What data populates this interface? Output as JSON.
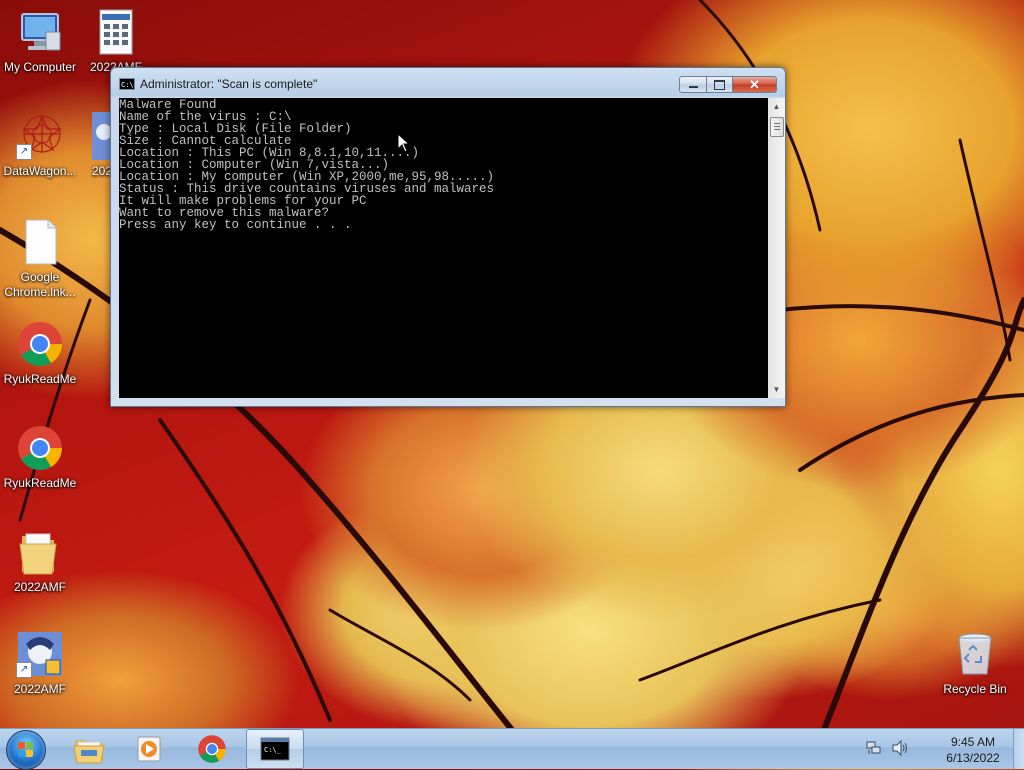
{
  "desktop": {
    "icons": [
      {
        "label": "My Computer",
        "icon": "computer-icon"
      },
      {
        "label": "2022AMF",
        "icon": "document-grid-icon"
      },
      {
        "label": "DataWagon...",
        "icon": "red-star-shortcut-icon"
      },
      {
        "label": "202",
        "icon": "anime-avatar-icon"
      },
      {
        "label": "Google Chrome.lnk...",
        "icon": "blank-file-icon"
      },
      {
        "label": "RyukReadMe",
        "icon": "chrome-icon"
      },
      {
        "label": "RyukReadMe",
        "icon": "chrome-icon"
      },
      {
        "label": "2022AMF",
        "icon": "folder-icon"
      },
      {
        "label": "2022AMF",
        "icon": "anime-avatar-icon"
      },
      {
        "label": "Recycle Bin",
        "icon": "recycle-bin-icon"
      }
    ]
  },
  "cmd_window": {
    "title": "Administrator:  \"Scan is complete\"",
    "app_icon_text": "C:\\",
    "lines": [
      "Malware Found",
      "Name of the virus : C:\\",
      "Type : Local Disk (File Folder)",
      "Size : Cannot calculate",
      "Location : This PC (Win 8,8.1,10,11....)",
      "Location : Computer (Win 7,vista...)",
      "Location : My computer (Win XP,2000,me,95,98.....)",
      "Status : This drive countains viruses and malwares",
      "It will make problems for your PC",
      "Want to remove this malware?",
      "Press any key to continue . . ."
    ]
  },
  "taskbar": {
    "pinned": [
      "start-orb",
      "explorer-icon",
      "media-player-icon",
      "chrome-icon",
      "cmd-icon"
    ],
    "clock": {
      "time": "9:45 AM",
      "date": "6/13/2022"
    }
  }
}
